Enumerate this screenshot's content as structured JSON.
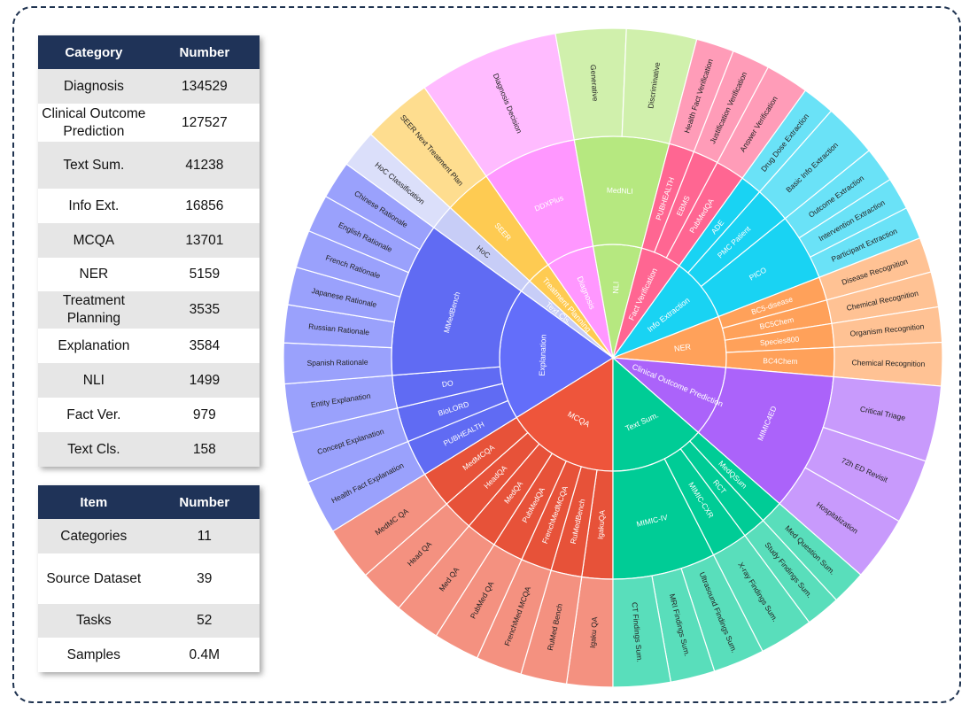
{
  "category_table": {
    "headers": [
      "Category",
      "Number"
    ],
    "rows": [
      {
        "category": "Diagnosis",
        "number": "134529"
      },
      {
        "category": "Clinical Outcome Prediction",
        "number": "127527"
      },
      {
        "category": "Text Sum.",
        "number": "41238"
      },
      {
        "category": "Info Ext.",
        "number": "16856"
      },
      {
        "category": "MCQA",
        "number": "13701"
      },
      {
        "category": "NER",
        "number": "5159"
      },
      {
        "category": "Treatment Planning",
        "number": "3535"
      },
      {
        "category": "Explanation",
        "number": "3584"
      },
      {
        "category": "NLI",
        "number": "1499"
      },
      {
        "category": "Fact Ver.",
        "number": "979"
      },
      {
        "category": "Text Cls.",
        "number": "158"
      }
    ]
  },
  "item_table": {
    "headers": [
      "Item",
      "Number"
    ],
    "rows": [
      {
        "item": "Categories",
        "number": "11"
      },
      {
        "item": "Source Dataset",
        "number": "39"
      },
      {
        "item": "Tasks",
        "number": "52"
      },
      {
        "item": "Samples",
        "number": "0.4M"
      }
    ]
  },
  "chart_data": {
    "type": "sunburst",
    "rings": [
      "category",
      "source dataset",
      "task"
    ],
    "categories": [
      {
        "name": "MCQA",
        "color": "#ee553b",
        "datasets": [
          {
            "name": "IgakuQA",
            "tasks": [
              "Igaku QA"
            ]
          },
          {
            "name": "RuMedBench",
            "tasks": [
              "RuMed Bench"
            ]
          },
          {
            "name": "FrenchMedMCQA",
            "tasks": [
              "FrenchMed MCQA"
            ]
          },
          {
            "name": "PubMedQA",
            "tasks": [
              "PubMed QA"
            ]
          },
          {
            "name": "MedQA",
            "tasks": [
              "Med QA"
            ]
          },
          {
            "name": "HeadQA",
            "tasks": [
              "Head QA"
            ]
          },
          {
            "name": "MedMCQA",
            "tasks": [
              "MedMC QA"
            ]
          }
        ]
      },
      {
        "name": "Explanation",
        "color": "#636efa",
        "datasets": [
          {
            "name": "PUBHEALTH",
            "tasks": [
              "Health Fact Explanation"
            ]
          },
          {
            "name": "BioLORD",
            "tasks": [
              "Concept Explanation"
            ]
          },
          {
            "name": "DO",
            "tasks": [
              "Entity Explanation"
            ]
          },
          {
            "name": "MMedBench",
            "tasks": [
              "Spanish Rationale",
              "Russian Rationale",
              "Japanese Rationale",
              "French Rationale",
              "English Rationale",
              "Chinese Rationale"
            ]
          }
        ]
      },
      {
        "name": "Text Cls.",
        "color": "#c7cdf7",
        "datasets": [
          {
            "name": "HoC",
            "tasks": [
              "HoC Classification"
            ]
          }
        ]
      },
      {
        "name": "Treatment Planning",
        "color": "#fecb52",
        "datasets": [
          {
            "name": "SEER",
            "tasks": [
              "SEER Next Treatment Plan"
            ]
          }
        ]
      },
      {
        "name": "Diagnosis",
        "color": "#ff97ff",
        "datasets": [
          {
            "name": "DDXPlus",
            "tasks": [
              "Diagnosis Decision"
            ]
          }
        ]
      },
      {
        "name": "NLI",
        "color": "#b6e880",
        "datasets": [
          {
            "name": "MedNLI",
            "tasks": [
              "Generative",
              "Discriminative"
            ]
          }
        ]
      },
      {
        "name": "Fact Verification",
        "color": "#ff6692",
        "datasets": [
          {
            "name": "PUBHEALTH",
            "tasks": [
              "Health Fact Verification"
            ]
          },
          {
            "name": "EBMS",
            "tasks": [
              "Justification Verification"
            ]
          },
          {
            "name": "PubMedQA",
            "tasks": [
              "Answer Verification"
            ]
          }
        ]
      },
      {
        "name": "Info Extraction",
        "color": "#19d3f3",
        "datasets": [
          {
            "name": "ADE",
            "tasks": [
              "Drug Dose Extraction"
            ]
          },
          {
            "name": "PMC Patient",
            "tasks": [
              "Basic Info Extraction"
            ]
          },
          {
            "name": "PICO",
            "tasks": [
              "Outcome Extraction",
              "Intervention Extraction",
              "Participant Extraction"
            ]
          }
        ]
      },
      {
        "name": "NER",
        "color": "#ffa15a",
        "datasets": [
          {
            "name": "BC5-disease",
            "tasks": [
              "Disease Recognition"
            ]
          },
          {
            "name": "BC5Chem",
            "tasks": [
              "Chemical Recognition"
            ]
          },
          {
            "name": "Species800",
            "tasks": [
              "Organism Recognition"
            ]
          },
          {
            "name": "BC4Chem",
            "tasks": [
              "Chemical Recognition"
            ]
          }
        ]
      },
      {
        "name": "Clinical Outcome Prediction",
        "color": "#ab63fa",
        "datasets": [
          {
            "name": "MIMIC4ED",
            "tasks": [
              "Critical Triage",
              "72h ED Revisit",
              "Hospitalization"
            ]
          }
        ]
      },
      {
        "name": "Text Sum.",
        "color": "#00cc96",
        "datasets": [
          {
            "name": "MedQSum",
            "tasks": [
              "Med Question Sum."
            ]
          },
          {
            "name": "RCT",
            "tasks": [
              "Study Findings Sum."
            ]
          },
          {
            "name": "MIMIC-CXR",
            "tasks": [
              "X-ray Findings Sum."
            ]
          },
          {
            "name": "MIMIC-IV",
            "tasks": [
              "Ultrasound Findings Sum.",
              "MRI Findings Sum.",
              "CT Findings Sum."
            ]
          }
        ]
      }
    ]
  }
}
